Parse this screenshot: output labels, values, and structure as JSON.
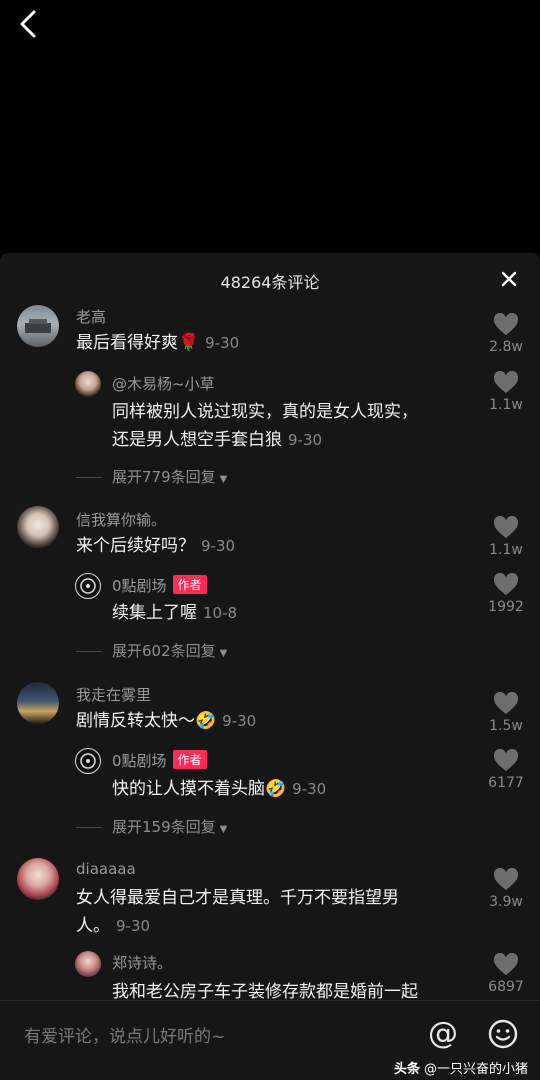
{
  "header": {
    "comment_count_title": "48264条评论"
  },
  "comments": [
    {
      "user": "老高",
      "text": "最后看得好爽🌹",
      "date": "9-30",
      "likes": "2.8w",
      "reply": {
        "user": "@木易杨~小草",
        "text_line1": "同样被别人说过现实，真的是女人现实，",
        "text_line2": "还是男人想空手套白狼",
        "date": "9-30",
        "likes": "1.1w"
      },
      "expand_label": "展开779条回复"
    },
    {
      "user": "信我算你输。",
      "text": "来个后续好吗？",
      "date": "9-30",
      "likes": "1.1w",
      "reply": {
        "user": "0點剧场",
        "badge": "作者",
        "text": "续集上了喔",
        "date": "10-8",
        "likes": "1992"
      },
      "expand_label": "展开602条回复"
    },
    {
      "user": "我走在雾里",
      "text": "剧情反转太快～🤣",
      "date": "9-30",
      "likes": "1.5w",
      "reply": {
        "user": "0點剧场",
        "badge": "作者",
        "text": "快的让人摸不着头脑🤣",
        "date": "9-30",
        "likes": "6177"
      },
      "expand_label": "展开159条回复"
    },
    {
      "user": "diaaaaa",
      "text_line1": "女人得最爱自己才是真理。千万不要指望男",
      "text_line2": "人。",
      "date": "9-30",
      "likes": "3.9w",
      "reply": {
        "user": "郑诗诗。",
        "text": "我和老公房子车子装修存款都是婚前一起",
        "likes": "6897"
      }
    }
  ],
  "input": {
    "placeholder": "有爱评论，说点儿好听的~",
    "at_symbol": "@"
  },
  "watermark": {
    "brand": "头条",
    "handle": "@一只兴奋的小猪"
  },
  "colors": {
    "author_badge": "#fe2c55",
    "panel_bg": "#161616"
  },
  "icons": [
    "back-icon",
    "close-icon",
    "heart-icon",
    "at-icon",
    "emoji-icon"
  ]
}
